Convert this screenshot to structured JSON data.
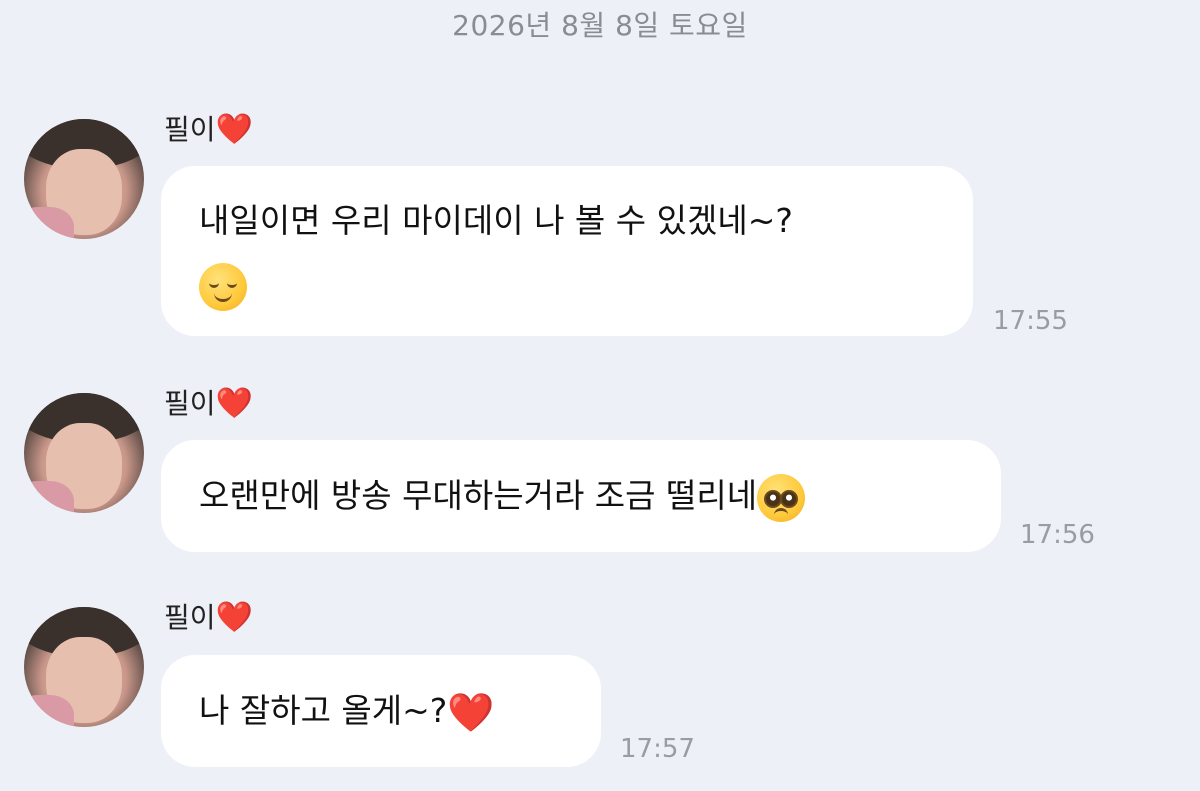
{
  "date_header": "2026년 8월 8일 토요일",
  "colors": {
    "background": "#eef0f7",
    "bubble": "#ffffff",
    "heart": "#e0282e",
    "timestamp": "#9a9ca3"
  },
  "messages": [
    {
      "sender": "필이",
      "sender_emoji": "❤️",
      "text_line1": "내일이면 우리 마이데이 나 볼 수 있겠네~?",
      "emoji": "relieved-face",
      "time": "17:55"
    },
    {
      "sender": "필이",
      "sender_emoji": "❤️",
      "text": "오랜만에 방송 무대하는거라 조금 떨리네",
      "emoji": "pleading-face",
      "time": "17:56"
    },
    {
      "sender": "필이",
      "sender_emoji": "❤️",
      "text": "나 잘하고 올게~?",
      "inline_emoji": "❤️",
      "time": "17:57"
    }
  ]
}
